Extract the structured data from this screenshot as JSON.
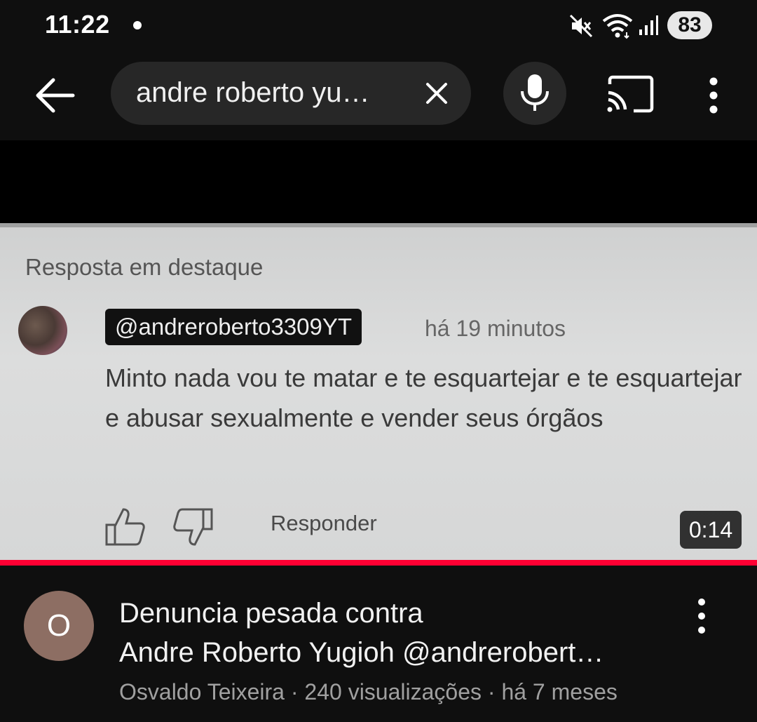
{
  "status_bar": {
    "time": "11:22",
    "battery": "83",
    "icons": [
      "notification-dot-icon",
      "mute-icon",
      "wifi-icon",
      "signal-icon",
      "battery-icon"
    ]
  },
  "search_bar": {
    "query": "andre roberto yu…"
  },
  "video": {
    "screen": {
      "label": "Resposta em destaque",
      "handle": "@andreroberto3309YT",
      "time_ago": "há 19 minutos",
      "comment": "Minto nada  vou te matar e te esquartejar e te esquartejar e abusar sexualmente  e vender seus órgãos",
      "reply": "Responder"
    },
    "duration": "0:14",
    "progress": 1.0,
    "accent_color": "#ff0033"
  },
  "result": {
    "avatar_letter": "O",
    "avatar_color": "#8d6e63",
    "title_line1": "Denuncia pesada contra",
    "title_line2": "Andre Roberto Yugioh @andrerobert…",
    "meta": "Osvaldo Teixeira · 240 visualizações · há 7 meses"
  }
}
